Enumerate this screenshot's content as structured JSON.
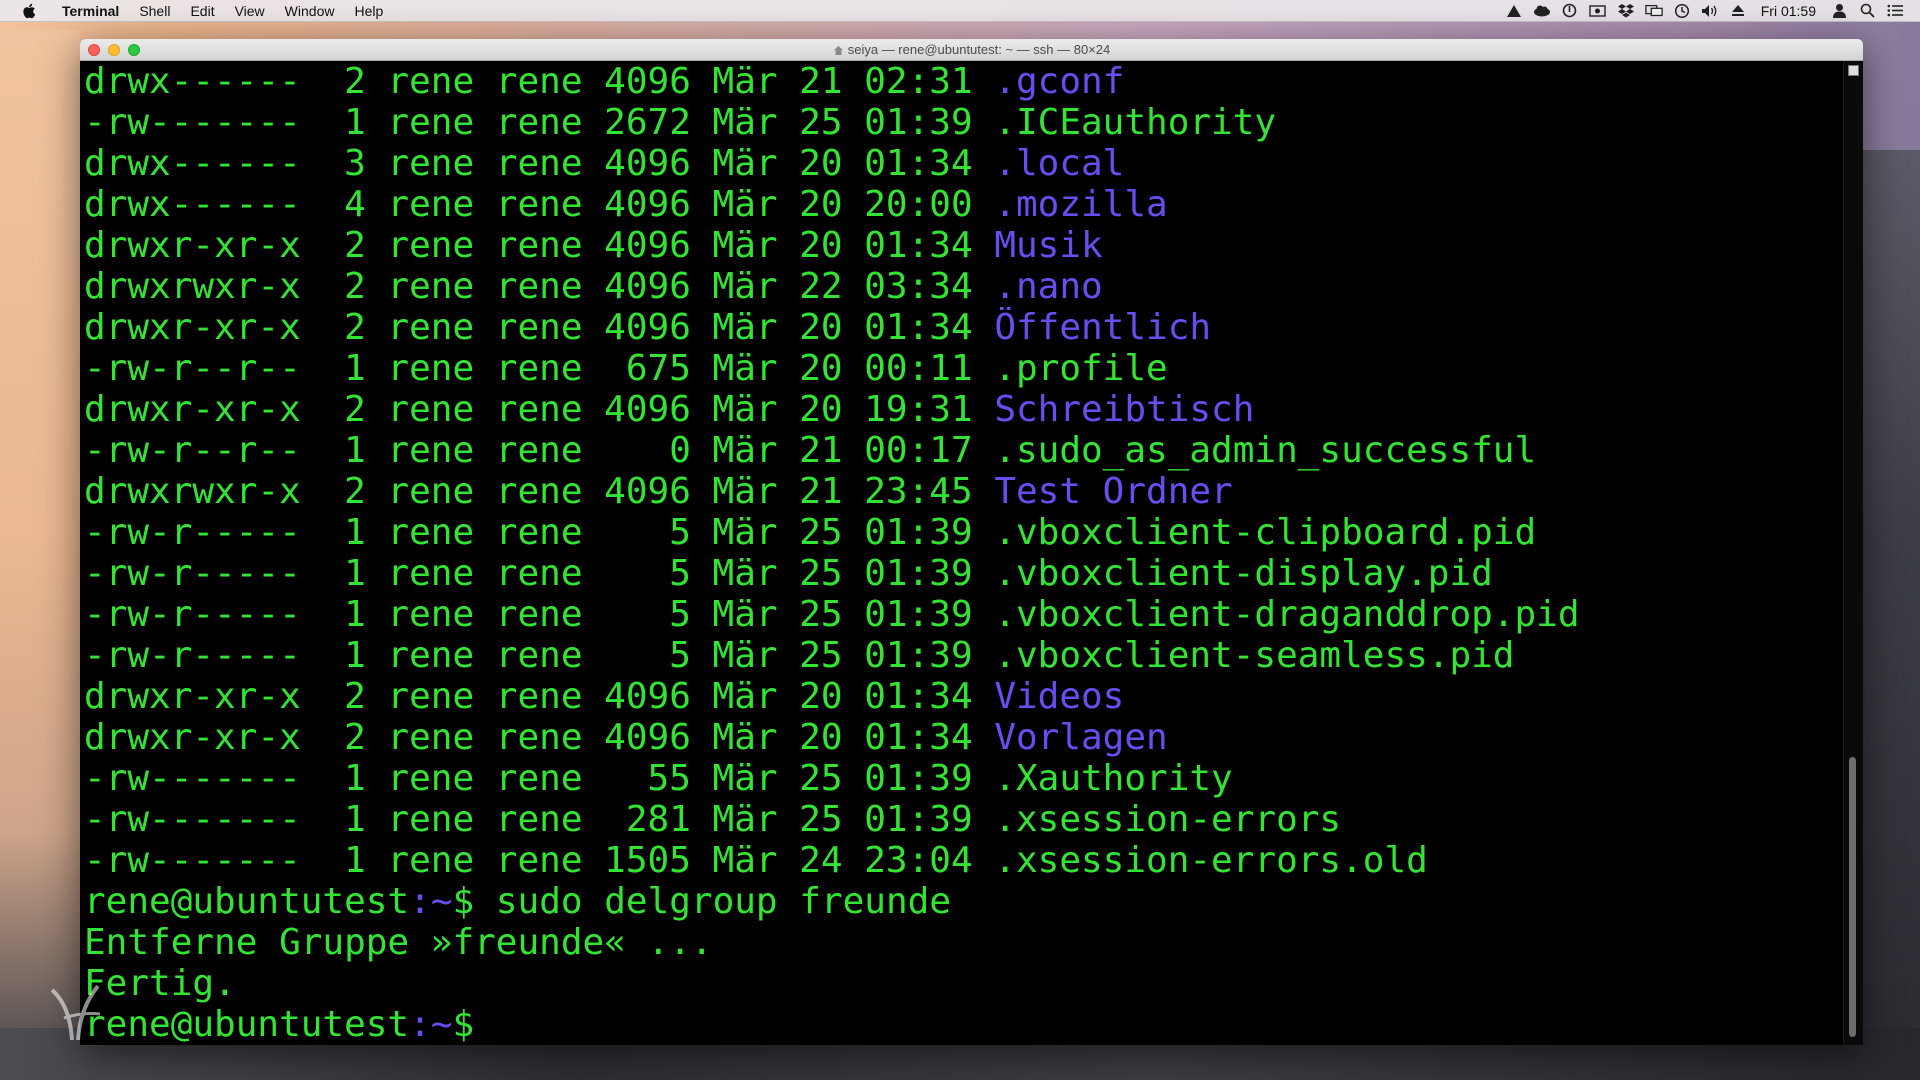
{
  "menubar": {
    "app_name": "Terminal",
    "items": [
      "Shell",
      "Edit",
      "View",
      "Window",
      "Help"
    ],
    "clock": "Fri 01:59",
    "status_icons": [
      "drive-icon",
      "creative-cloud-icon",
      "power-icon",
      "screen-record-icon",
      "dropbox-icon",
      "display-mirror-icon",
      "time-machine-icon",
      "volume-icon",
      "eject-icon",
      "user-icon",
      "spotlight-icon",
      "notification-center-icon"
    ]
  },
  "window": {
    "title": "seiya — rene@ubuntutest: ~ — ssh — 80×24"
  },
  "terminal": {
    "lines": [
      {
        "meta": "drwx------  2 rene rene 4096 Mär 21 02:31 ",
        "name": ".gconf",
        "kind": "dir"
      },
      {
        "meta": "-rw-------  1 rene rene 2672 Mär 25 01:39 ",
        "name": ".ICEauthority",
        "kind": "file"
      },
      {
        "meta": "drwx------  3 rene rene 4096 Mär 20 01:34 ",
        "name": ".local",
        "kind": "dir"
      },
      {
        "meta": "drwx------  4 rene rene 4096 Mär 20 20:00 ",
        "name": ".mozilla",
        "kind": "dir"
      },
      {
        "meta": "drwxr-xr-x  2 rene rene 4096 Mär 20 01:34 ",
        "name": "Musik",
        "kind": "dir"
      },
      {
        "meta": "drwxrwxr-x  2 rene rene 4096 Mär 22 03:34 ",
        "name": ".nano",
        "kind": "dir"
      },
      {
        "meta": "drwxr-xr-x  2 rene rene 4096 Mär 20 01:34 ",
        "name": "Öffentlich",
        "kind": "dir"
      },
      {
        "meta": "-rw-r--r--  1 rene rene  675 Mär 20 00:11 ",
        "name": ".profile",
        "kind": "file"
      },
      {
        "meta": "drwxr-xr-x  2 rene rene 4096 Mär 20 19:31 ",
        "name": "Schreibtisch",
        "kind": "dir"
      },
      {
        "meta": "-rw-r--r--  1 rene rene    0 Mär 21 00:17 ",
        "name": ".sudo_as_admin_successful",
        "kind": "file"
      },
      {
        "meta": "drwxrwxr-x  2 rene rene 4096 Mär 21 23:45 ",
        "name": "Test Ordner",
        "kind": "dir"
      },
      {
        "meta": "-rw-r-----  1 rene rene    5 Mär 25 01:39 ",
        "name": ".vboxclient-clipboard.pid",
        "kind": "file"
      },
      {
        "meta": "-rw-r-----  1 rene rene    5 Mär 25 01:39 ",
        "name": ".vboxclient-display.pid",
        "kind": "file"
      },
      {
        "meta": "-rw-r-----  1 rene rene    5 Mär 25 01:39 ",
        "name": ".vboxclient-draganddrop.pid",
        "kind": "file"
      },
      {
        "meta": "-rw-r-----  1 rene rene    5 Mär 25 01:39 ",
        "name": ".vboxclient-seamless.pid",
        "kind": "file"
      },
      {
        "meta": "drwxr-xr-x  2 rene rene 4096 Mär 20 01:34 ",
        "name": "Videos",
        "kind": "dir"
      },
      {
        "meta": "drwxr-xr-x  2 rene rene 4096 Mär 20 01:34 ",
        "name": "Vorlagen",
        "kind": "dir"
      },
      {
        "meta": "-rw-------  1 rene rene   55 Mär 25 01:39 ",
        "name": ".Xauthority",
        "kind": "file"
      },
      {
        "meta": "-rw-------  1 rene rene  281 Mär 25 01:39 ",
        "name": ".xsession-errors",
        "kind": "file"
      },
      {
        "meta": "-rw-------  1 rene rene 1505 Mär 24 23:04 ",
        "name": ".xsession-errors.old",
        "kind": "file"
      }
    ],
    "prompt_user": "rene@ubuntutest",
    "prompt_sep": ":",
    "prompt_path": "~",
    "prompt_symbol": "$ ",
    "command": "sudo delgroup freunde",
    "output": [
      "Entferne Gruppe »freunde« ...",
      "Fertig."
    ]
  },
  "colors": {
    "terminal_text": "#33e533",
    "directory": "#6a4cf0",
    "terminal_bg": "#000000"
  }
}
